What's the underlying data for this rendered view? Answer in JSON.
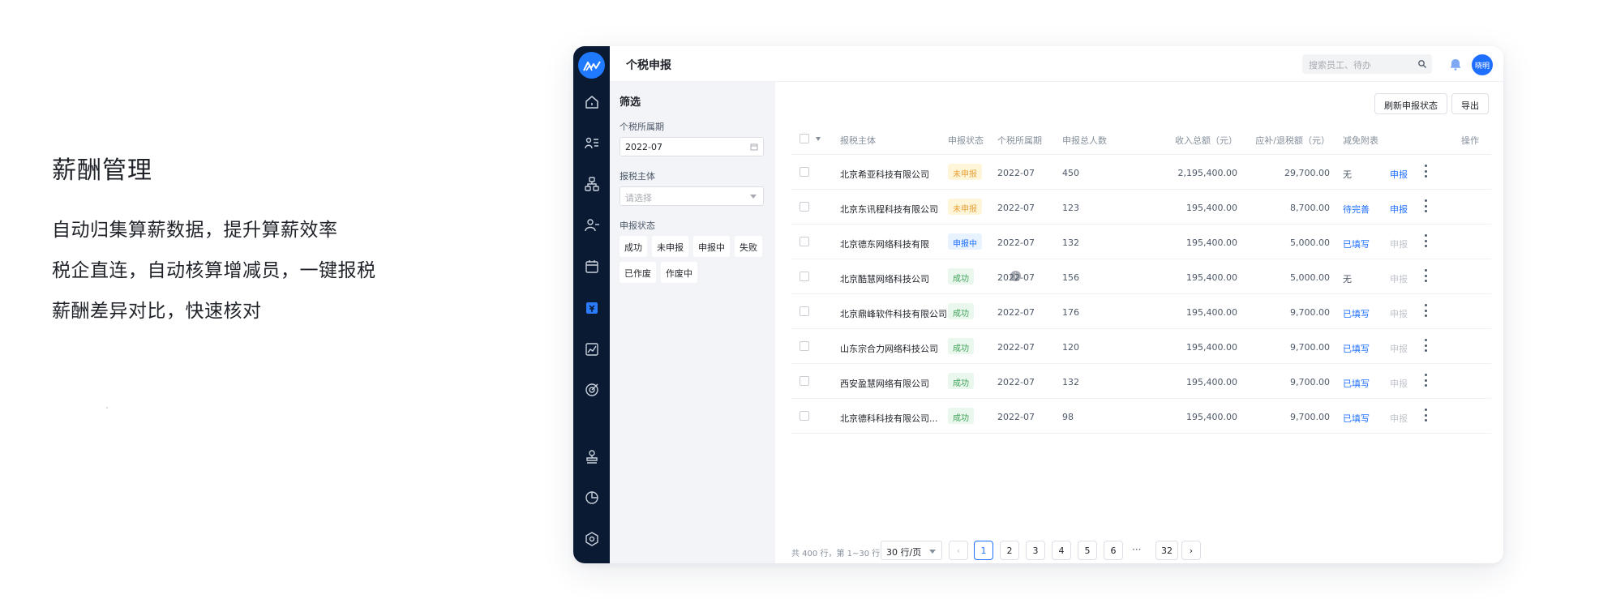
{
  "promo": {
    "title": "薪酬管理",
    "lines": [
      "自动归集算薪数据，提升算薪效率",
      "税企直连，自动核算增减员，一键报税",
      "薪酬差异对比，快速核对"
    ]
  },
  "header": {
    "title": "个税申报",
    "search_placeholder": "搜索员工、待办",
    "avatar": "晓明"
  },
  "sidebar": {
    "icons": [
      "home-icon",
      "list-icon",
      "org-icon",
      "user-icon",
      "calendar-icon",
      "salary-icon",
      "chart-icon",
      "target-icon",
      "stamp-icon",
      "pie-icon",
      "settings-icon"
    ]
  },
  "filter": {
    "heading": "筛选",
    "period_label": "个税所属期",
    "period_value": "2022-07",
    "entity_label": "报税主体",
    "entity_placeholder": "请选择",
    "status_label": "申报状态",
    "status_options": [
      "成功",
      "未申报",
      "申报中",
      "失败",
      "已作废",
      "作废中"
    ]
  },
  "toolbar": {
    "refresh_label": "刷新申报状态",
    "export_label": "导出"
  },
  "table": {
    "columns": [
      "报税主体",
      "申报状态",
      "个税所属期",
      "申报总人数",
      "收入总额（元）",
      "应补/退税额（元）",
      "减免附表",
      "操作"
    ],
    "rows": [
      {
        "entity": "北京希亚科技有限公司",
        "status": "未申报",
        "kind": "warn",
        "period": "2022-07",
        "count": "450",
        "income": "2,195,400.00",
        "tax": "29,700.00",
        "annex": "无",
        "annex_link": false,
        "action": "申报",
        "action_enabled": true,
        "info": false
      },
      {
        "entity": "北京东讯程科技有限公司",
        "status": "未申报",
        "kind": "warn",
        "period": "2022-07",
        "count": "123",
        "income": "195,400.00",
        "tax": "8,700.00",
        "annex": "待完善",
        "annex_link": true,
        "action": "申报",
        "action_enabled": true,
        "info": false
      },
      {
        "entity": "北京德东网络科技有限",
        "status": "申报中",
        "kind": "proc",
        "period": "2022-07",
        "count": "132",
        "income": "195,400.00",
        "tax": "5,000.00",
        "annex": "已填写",
        "annex_link": true,
        "action": "申报",
        "action_enabled": false,
        "info": false
      },
      {
        "entity": "北京酷慧网络科技公司",
        "status": "成功",
        "kind": "ok",
        "period": "2022-07",
        "count": "156",
        "income": "195,400.00",
        "tax": "5,000.00",
        "annex": "无",
        "annex_link": false,
        "action": "申报",
        "action_enabled": false,
        "info": true
      },
      {
        "entity": "北京鼎峰软件科技有限公司",
        "status": "成功",
        "kind": "ok",
        "period": "2022-07",
        "count": "176",
        "income": "195,400.00",
        "tax": "9,700.00",
        "annex": "已填写",
        "annex_link": true,
        "action": "申报",
        "action_enabled": false,
        "info": false
      },
      {
        "entity": "山东宗合力网络科技公司",
        "status": "成功",
        "kind": "ok",
        "period": "2022-07",
        "count": "120",
        "income": "195,400.00",
        "tax": "9,700.00",
        "annex": "已填写",
        "annex_link": true,
        "action": "申报",
        "action_enabled": false,
        "info": false
      },
      {
        "entity": "西安盈慧网络有限公司",
        "status": "成功",
        "kind": "ok",
        "period": "2022-07",
        "count": "132",
        "income": "195,400.00",
        "tax": "9,700.00",
        "annex": "已填写",
        "annex_link": true,
        "action": "申报",
        "action_enabled": false,
        "info": false
      },
      {
        "entity": "北京德科科技有限公司...",
        "status": "成功",
        "kind": "ok",
        "period": "2022-07",
        "count": "98",
        "income": "195,400.00",
        "tax": "9,700.00",
        "annex": "已填写",
        "annex_link": true,
        "action": "申报",
        "action_enabled": false,
        "info": false
      }
    ]
  },
  "pagination": {
    "info": "共 400 行，第 1~30 行",
    "page_size": "30 行/页",
    "pages": [
      "1",
      "2",
      "3",
      "4",
      "5",
      "6"
    ],
    "ellipsis": "···",
    "last": "32",
    "prev": "‹",
    "next": "›"
  }
}
